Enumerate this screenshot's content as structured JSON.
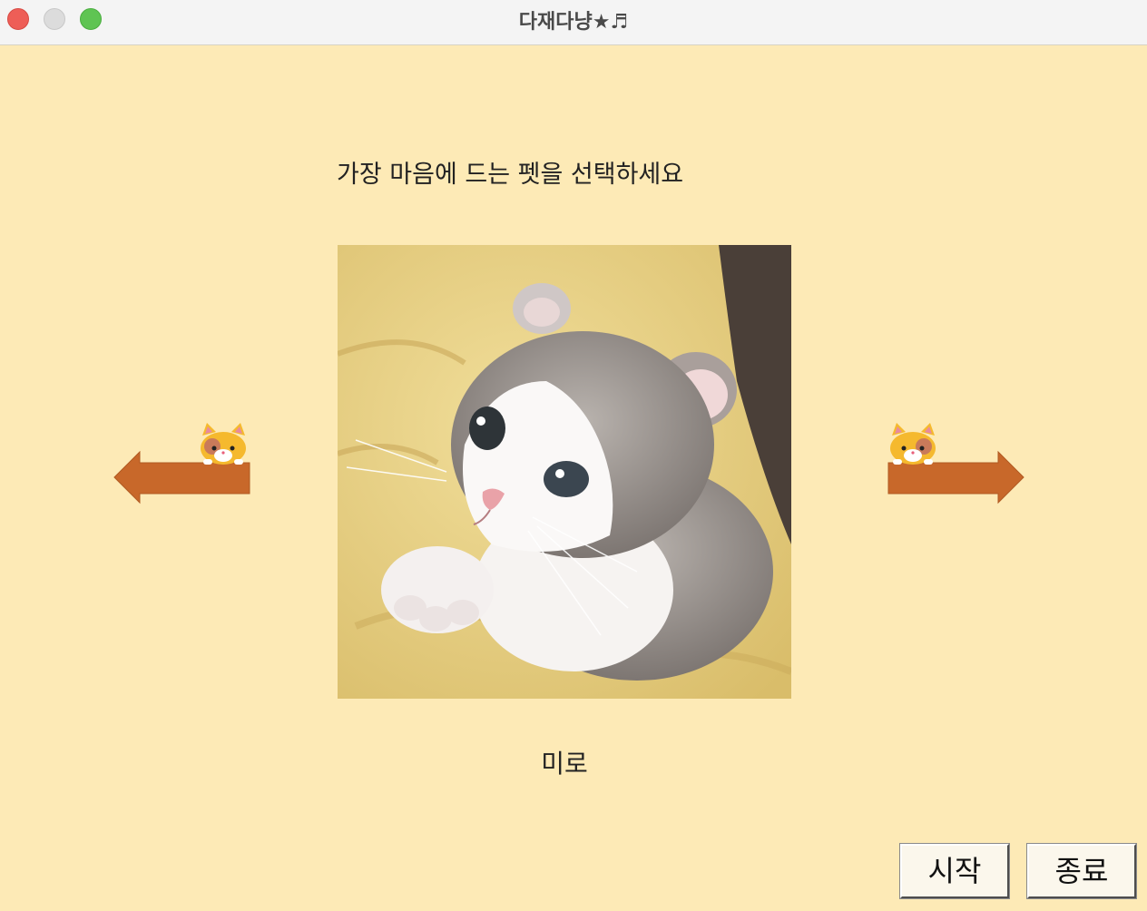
{
  "window": {
    "title": "다재다냥★♬"
  },
  "main": {
    "prompt": "가장 마음에 드는 펫을 선택하세요",
    "pet_name": "미로",
    "photo_icon": "kitten-photo"
  },
  "navigation": {
    "prev_icon": "left-arrow-cat-icon",
    "next_icon": "right-arrow-cat-icon",
    "arrow_color": "#c8682a"
  },
  "buttons": {
    "start_label": "시작",
    "quit_label": "종료"
  },
  "colors": {
    "background": "#fdeab6",
    "titlebar": "#f4f4f4",
    "text": "#222222"
  }
}
